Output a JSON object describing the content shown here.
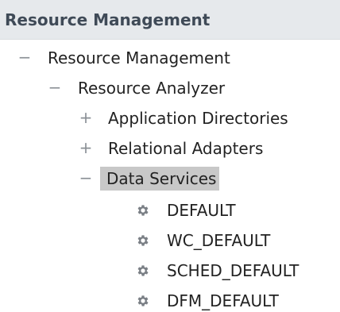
{
  "panel": {
    "title": "Resource Management"
  },
  "tree": {
    "root": {
      "toggle": "−",
      "label": "Resource Management"
    },
    "analyzer": {
      "toggle": "−",
      "label": "Resource Analyzer"
    },
    "children": [
      {
        "toggle": "+",
        "label": "Application Directories"
      },
      {
        "toggle": "+",
        "label": "Relational Adapters"
      },
      {
        "toggle": "−",
        "label": "Data Services",
        "selected": true
      }
    ],
    "services": [
      {
        "icon": "gear-icon",
        "label": "DEFAULT"
      },
      {
        "icon": "gear-icon",
        "label": "WC_DEFAULT"
      },
      {
        "icon": "gear-icon",
        "label": "SCHED_DEFAULT"
      },
      {
        "icon": "gear-icon",
        "label": "DFM_DEFAULT"
      }
    ]
  },
  "colors": {
    "header_bg": "#e6e9ec",
    "header_text": "#3f4a57",
    "selection_bg": "#c8c8c8",
    "icon_gray": "#7a7f85"
  }
}
